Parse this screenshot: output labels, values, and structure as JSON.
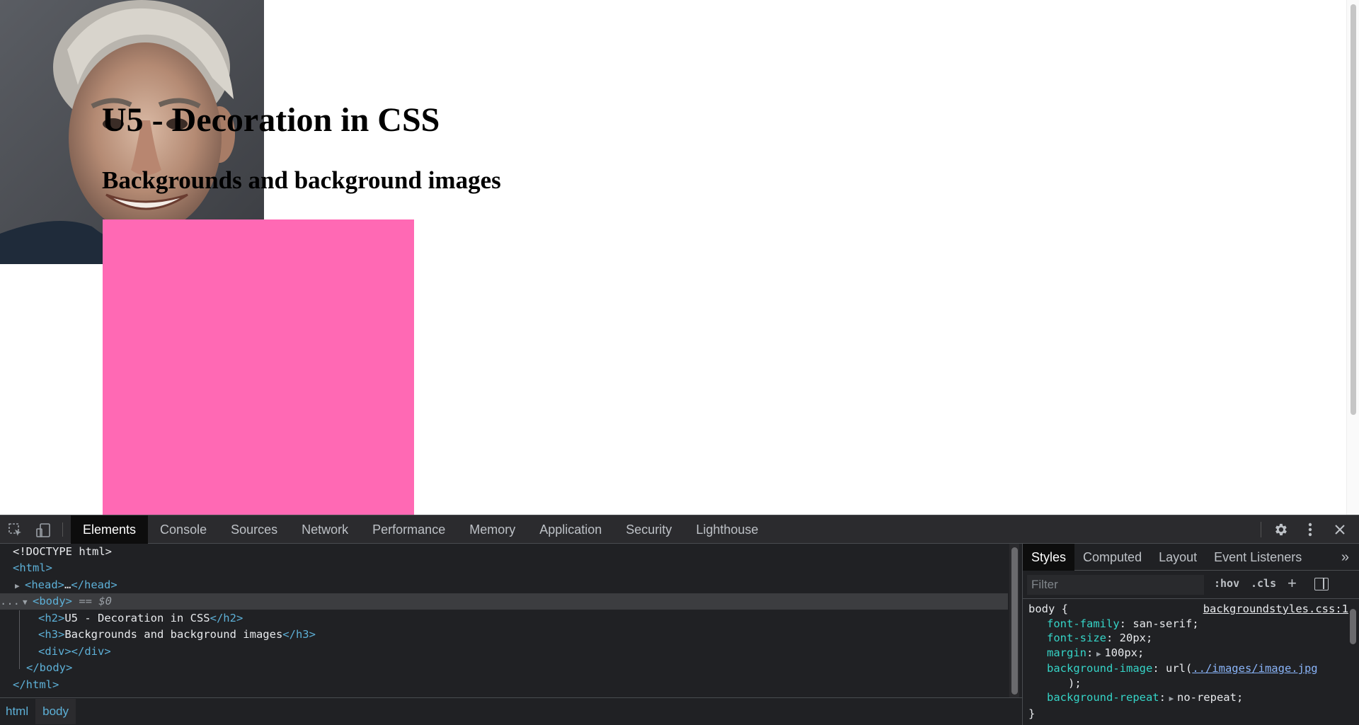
{
  "page": {
    "heading": "U5 - Decoration in CSS",
    "subheading": "Backgrounds and background images",
    "div_color": "#ff69b4"
  },
  "devtools": {
    "tabs": [
      "Elements",
      "Console",
      "Sources",
      "Network",
      "Performance",
      "Memory",
      "Application",
      "Security",
      "Lighthouse"
    ],
    "active_tab": "Elements",
    "dom": {
      "doctype": "<!DOCTYPE html>",
      "html_open": "<html>",
      "head_tag_open": "<head>",
      "head_ellipsis": "…",
      "head_tag_close": "</head>",
      "body_open": "<body>",
      "body_marker": "== $0",
      "ellipsis": "...",
      "h2_open": "<h2>",
      "h2_text": "U5 - Decoration in CSS",
      "h2_close": "</h2>",
      "h3_open": "<h3>",
      "h3_text": "Backgrounds and background images",
      "h3_close": "</h3>",
      "div_tag": "<div></div>",
      "body_close": "</body>",
      "html_close": "</html>"
    },
    "breadcrumb": [
      "html",
      "body"
    ],
    "styles": {
      "tabs": [
        "Styles",
        "Computed",
        "Layout",
        "Event Listeners"
      ],
      "active_tab": "Styles",
      "filter_placeholder": "Filter",
      "hov": ":hov",
      "cls": ".cls",
      "selector": "body {",
      "source": "backgroundstyles.css:1",
      "declarations": {
        "font_family_prop": "font-family",
        "font_family_val": "san-serif;",
        "font_size_prop": "font-size",
        "font_size_val": "20px;",
        "margin_prop": "margin",
        "margin_val": "100px;",
        "bg_image_prop": "background-image",
        "bg_image_url_prefix": "url(",
        "bg_image_url": "../images/image.jpg",
        "bg_image_url_suffix": ");",
        "bg_repeat_prop": "background-repeat",
        "bg_repeat_val": "no-repeat;"
      },
      "close_brace": "}"
    }
  }
}
